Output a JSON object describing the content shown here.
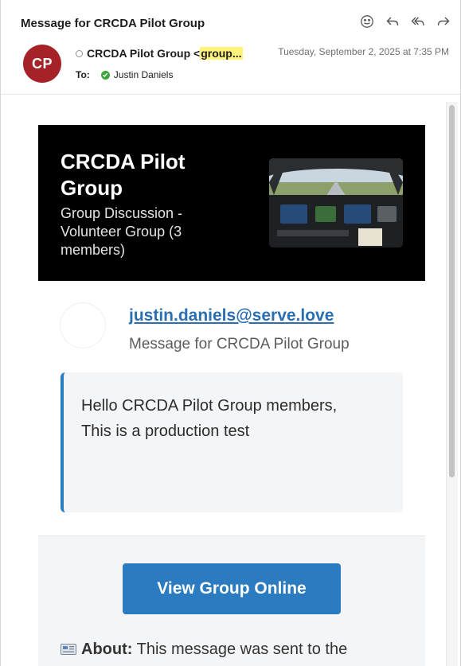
{
  "header": {
    "subject": "Message for CRCDA Pilot Group",
    "from_name": "CRCDA Pilot Group <",
    "from_addr_partial": "group...",
    "date": "Tuesday, September 2, 2025 at 7:35 PM",
    "to_label": "To:",
    "to_name": "Justin Daniels",
    "avatar_initials": "CP",
    "avatar_color": "#a52328"
  },
  "toolbar": {
    "icons": [
      "smiley-icon",
      "reply-icon",
      "reply-all-icon",
      "forward-icon"
    ]
  },
  "banner": {
    "title": "CRCDA Pilot Group",
    "subtitle": "Group Discussion - Volunteer Group (3 members)"
  },
  "sender": {
    "email": "justin.daniels@serve.love",
    "subject": "Message for CRCDA Pilot Group"
  },
  "message": {
    "line1": "Hello CRCDA Pilot Group members,",
    "line2": "This is a production test"
  },
  "footer": {
    "button_label": "View Group Online",
    "about_label": "About:",
    "about_text": "This message was sent to the"
  },
  "colors": {
    "accent": "#2a7bbf",
    "highlight": "#fff37a"
  }
}
